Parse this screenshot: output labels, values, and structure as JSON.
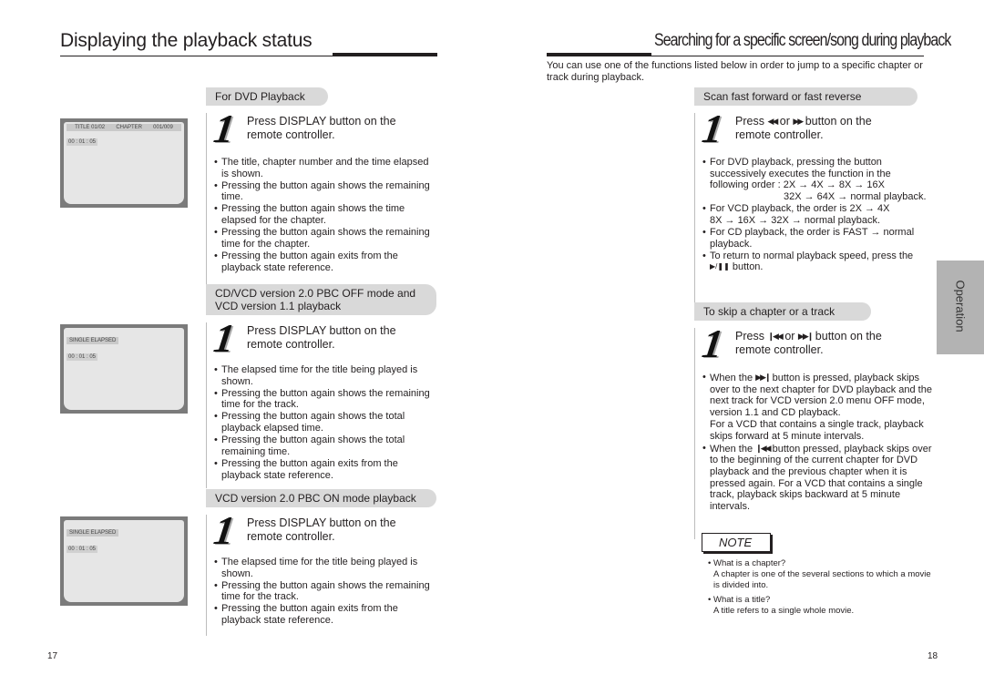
{
  "left_page": {
    "title": "Displaying the playback status",
    "page_number": "17",
    "sections": [
      {
        "header": "For DVD Playback",
        "step_number": "1",
        "step_text": "Press DISPLAY button on the remote controller.",
        "bullets": [
          "The title, chapter number and the time elapsed is shown.",
          "Pressing the button again shows the remaining time.",
          "Pressing the button again shows the time elapsed for the chapter.",
          "Pressing the button again shows the remaining time for the chapter.",
          "Pressing the button again exits from the playback state reference."
        ],
        "screen": {
          "title_label": "TITLE 01/02",
          "chapter_label": "CHAPTER",
          "chapter_value": "001/009",
          "time": "00 : 01 : 05"
        }
      },
      {
        "header": "CD/VCD version 2.0 PBC OFF mode and VCD version 1.1 playback",
        "step_number": "1",
        "step_text": "Press DISPLAY button on the remote controller.",
        "bullets": [
          "The elapsed time for the title being played is shown.",
          "Pressing the button again shows the remaining time for the track.",
          "Pressing the button again shows the total playback elapsed time.",
          "Pressing the button again shows the total remaining time.",
          "Pressing the button again exits from the playback state reference."
        ],
        "screen": {
          "mode_label": "SINGLE ELAPSED",
          "time": "00 : 01 : 05"
        }
      },
      {
        "header": "VCD version 2.0 PBC ON mode playback",
        "step_number": "1",
        "step_text": "Press DISPLAY button on the remote controller.",
        "bullets": [
          "The elapsed time for the title being played is shown.",
          "Pressing the button again shows the remaining time for the track.",
          "Pressing the button again exits from the playback state reference."
        ],
        "screen": {
          "mode_label": "SINGLE ELAPSED",
          "time": "00 : 01 : 05"
        }
      }
    ]
  },
  "right_page": {
    "title": "Searching for a specific screen/song during playback",
    "intro": "You can use one of the functions listed below in order to jump to a specific chapter or track during playback.",
    "page_number": "18",
    "side_tab": "Operation",
    "scan": {
      "header": "Scan fast forward or fast reverse",
      "step_number": "1",
      "step_pre": "Press",
      "icon_rew": "◀◀",
      "step_or": "or",
      "icon_ff": "▶▶",
      "step_post": "button on the remote controller.",
      "bullets": {
        "dvd_1": "For DVD playback, pressing the button successively executes the function in the following order : 2X → 4X → 8X → 16X",
        "dvd_2": "32X → 64X → normal playback.",
        "vcd_1": "For VCD playback, the order is 2X → 4X",
        "vcd_2": "8X → 16X → 32X → normal playback.",
        "cd": "For CD playback, the order is FAST → normal playback.",
        "return_pre": "To return to normal playback speed, press the",
        "return_icon": "▶/❚❚",
        "return_post": "button."
      }
    },
    "skip": {
      "header": "To skip a chapter or a track",
      "step_number": "1",
      "step_pre": "Press",
      "icon_prev": "❙◀◀",
      "step_or": "or",
      "icon_next": "▶▶❙",
      "step_post": "button on the remote controller.",
      "b1_pre": "When the",
      "b1_icon": "▶▶❙",
      "b1_post": "button is pressed, playback skips over to the next chapter for DVD playback and the next track for VCD version 2.0 menu OFF mode, version 1.1 and CD playback.",
      "b1_extra": "For a VCD that contains a single track, playback skips forward at 5 minute intervals.",
      "b2_pre": "When the",
      "b2_icon": "❙◀◀",
      "b2_post": "button pressed, playback skips over to the beginning of the current chapter for DVD playback and the previous chapter when it is pressed again. For a VCD that contains a single track, playback skips backward at 5 minute intervals."
    },
    "note": {
      "label": "NOTE",
      "items": [
        {
          "q": "What is a chapter?",
          "a": "A chapter is one of the several sections to which a movie is divided into."
        },
        {
          "q": "What is a title?",
          "a": "A title refers to a single whole movie."
        }
      ]
    }
  }
}
